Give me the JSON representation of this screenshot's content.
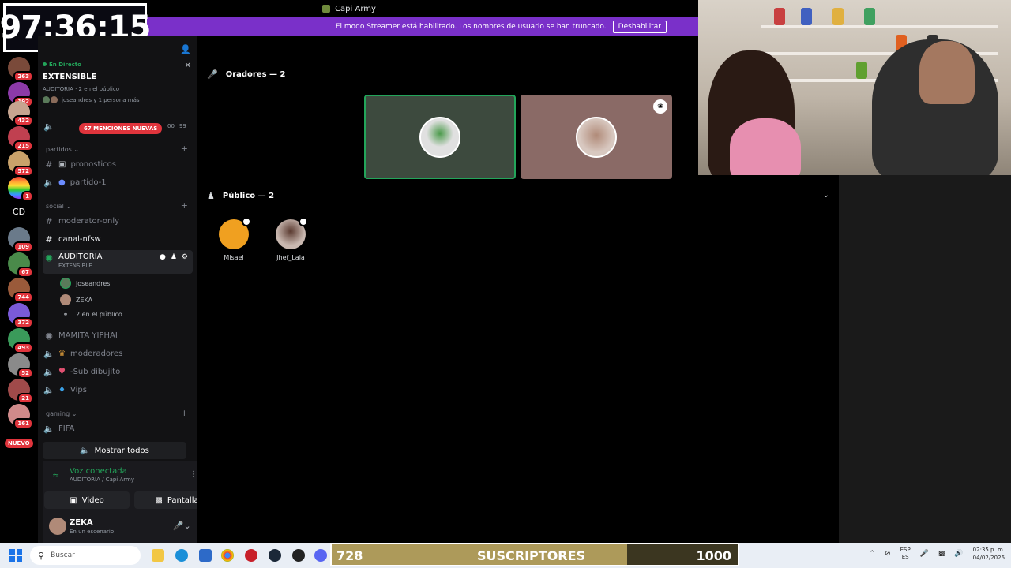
{
  "window": {
    "title": "Capi Army"
  },
  "streamer_banner": {
    "text": "El modo Streamer está habilitado. Los nombres de usuario se han truncado.",
    "button": "Deshabilitar"
  },
  "timer": {
    "text": "97:36:15"
  },
  "server_rail": {
    "badges": [
      "263",
      "192",
      "432",
      "215",
      "572",
      "1",
      "109",
      "67",
      "744",
      "372",
      "493",
      "52",
      "21",
      "161"
    ],
    "cd_label": "CD",
    "nuevo": "NUEVO"
  },
  "live": {
    "status": "En Directo",
    "title": "EXTENSIBLE",
    "meta": "AUDITORIA · 2 en el público",
    "people": "joseandres y 1 persona más"
  },
  "mentions": {
    "label": "67 MENCIONES NUEVAS",
    "c1": "00",
    "c2": "99"
  },
  "categories": {
    "partidos": "partidos",
    "social": "social",
    "gaming": "gaming"
  },
  "channels": {
    "pronosticos": "pronosticos",
    "partido1": "partido-1",
    "moderator_only": "moderator-only",
    "canal_nfsw": "canal-nfsw",
    "auditoria": "AUDITORIA",
    "auditoria_sub": "EXTENSIBLE",
    "user1": "joseandres",
    "user2": "ZEKA",
    "audience": "2 en el público",
    "mamita": "MAMITA YIPHAI",
    "moderadores": "moderadores",
    "sub_dibujito": "-Sub dibujito",
    "vips": "Vips",
    "fifa": "FIFA"
  },
  "show_all": "Mostrar todos",
  "voice": {
    "status": "Voz conectada",
    "location": "AUDITORIA / Capi Army",
    "video_btn": "Video",
    "screen_btn": "Pantalla"
  },
  "user": {
    "name": "ZEKA",
    "status": "En un escenario"
  },
  "stage": {
    "speakers_header": "Oradores — 2",
    "audience_header": "Público — 2",
    "audience": [
      {
        "name": "Misael"
      },
      {
        "name": "Jhef_Lala"
      }
    ]
  },
  "taskbar": {
    "search_placeholder": "Buscar",
    "lang_1": "ESP",
    "lang_2": "ES",
    "time": "02:35 p. m.",
    "date": "04/02/2026"
  },
  "sub_goal": {
    "current": "728",
    "label": "SUSCRIPTORES",
    "goal": "1000",
    "progress": 0.728
  },
  "colors": {
    "streamer_banner": "#7a30c9",
    "online": "#23a55a",
    "mention": "#e0343c"
  }
}
